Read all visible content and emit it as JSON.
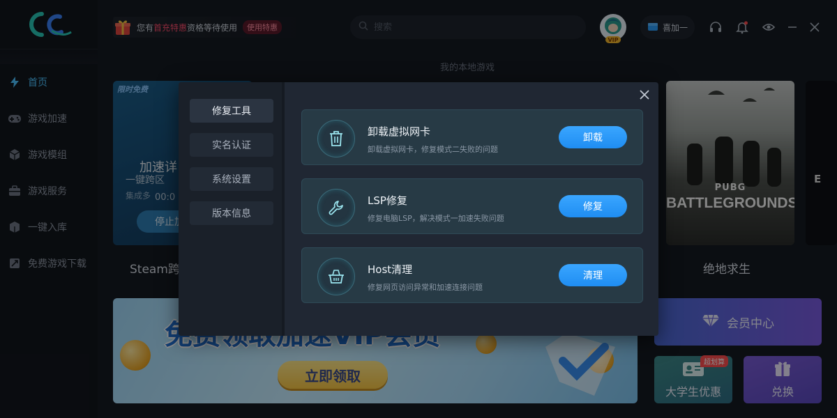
{
  "promo": {
    "prefix": "您有",
    "highlight": "首充特惠",
    "suffix": "资格等待使用",
    "badge": "使用特惠"
  },
  "search": {
    "placeholder": "搜索"
  },
  "avatar": {
    "badge": "VIP"
  },
  "speed_button": {
    "label": "喜加一"
  },
  "sidebar": {
    "items": [
      {
        "label": "首页",
        "icon": "lightning-icon",
        "active": true
      },
      {
        "label": "游戏加速",
        "icon": "gamepad-icon"
      },
      {
        "label": "游戏模组",
        "icon": "cube-icon"
      },
      {
        "label": "游戏服务",
        "icon": "toolbox-icon"
      },
      {
        "label": "一键入库",
        "icon": "box-icon"
      },
      {
        "label": "免费游戏下载",
        "icon": "download-icon"
      }
    ]
  },
  "main": {
    "section_title": "我的本地游戏",
    "steam_card": {
      "tag": "限时免费",
      "line1": "加速详",
      "line2": "一键跨区",
      "line3": "集成多",
      "timer": "00:0",
      "stop_label": "停止加",
      "caption": "Steam跨"
    },
    "pubg_card": {
      "logo_small": "PUBG",
      "logo_big": "BATTLEGROUNDS",
      "caption": "绝地求生"
    },
    "edge_card": {
      "letter": "E"
    },
    "banner": {
      "headline": "免费领取加速VIP会员",
      "claim": "立即领取"
    },
    "member_center": "会员中心",
    "student_tile": {
      "label": "大学生优惠",
      "tag": "超划算"
    },
    "redeem_tile": {
      "label": "兑换"
    }
  },
  "modal": {
    "tabs": [
      "修复工具",
      "实名认证",
      "系统设置",
      "版本信息"
    ],
    "active_tab": 0,
    "tools": [
      {
        "title": "卸载虚拟网卡",
        "desc": "卸载虚拟网卡，修复模式二失败的问题",
        "button": "卸载",
        "icon": "trash-icon"
      },
      {
        "title": "LSP修复",
        "desc": "修复电脑LSP，解决模式一加速失败问题",
        "button": "修复",
        "icon": "wrench-icon"
      },
      {
        "title": "Host清理",
        "desc": "修复网页访问异常和加速连接问题",
        "button": "清理",
        "icon": "basket-icon"
      }
    ]
  },
  "colors": {
    "accent": "#4ec3ff",
    "button_blue": "#2a9bf8",
    "promo_red": "#ff4d6d",
    "modal_bg": "#202733",
    "card_bg": "#273a45"
  }
}
